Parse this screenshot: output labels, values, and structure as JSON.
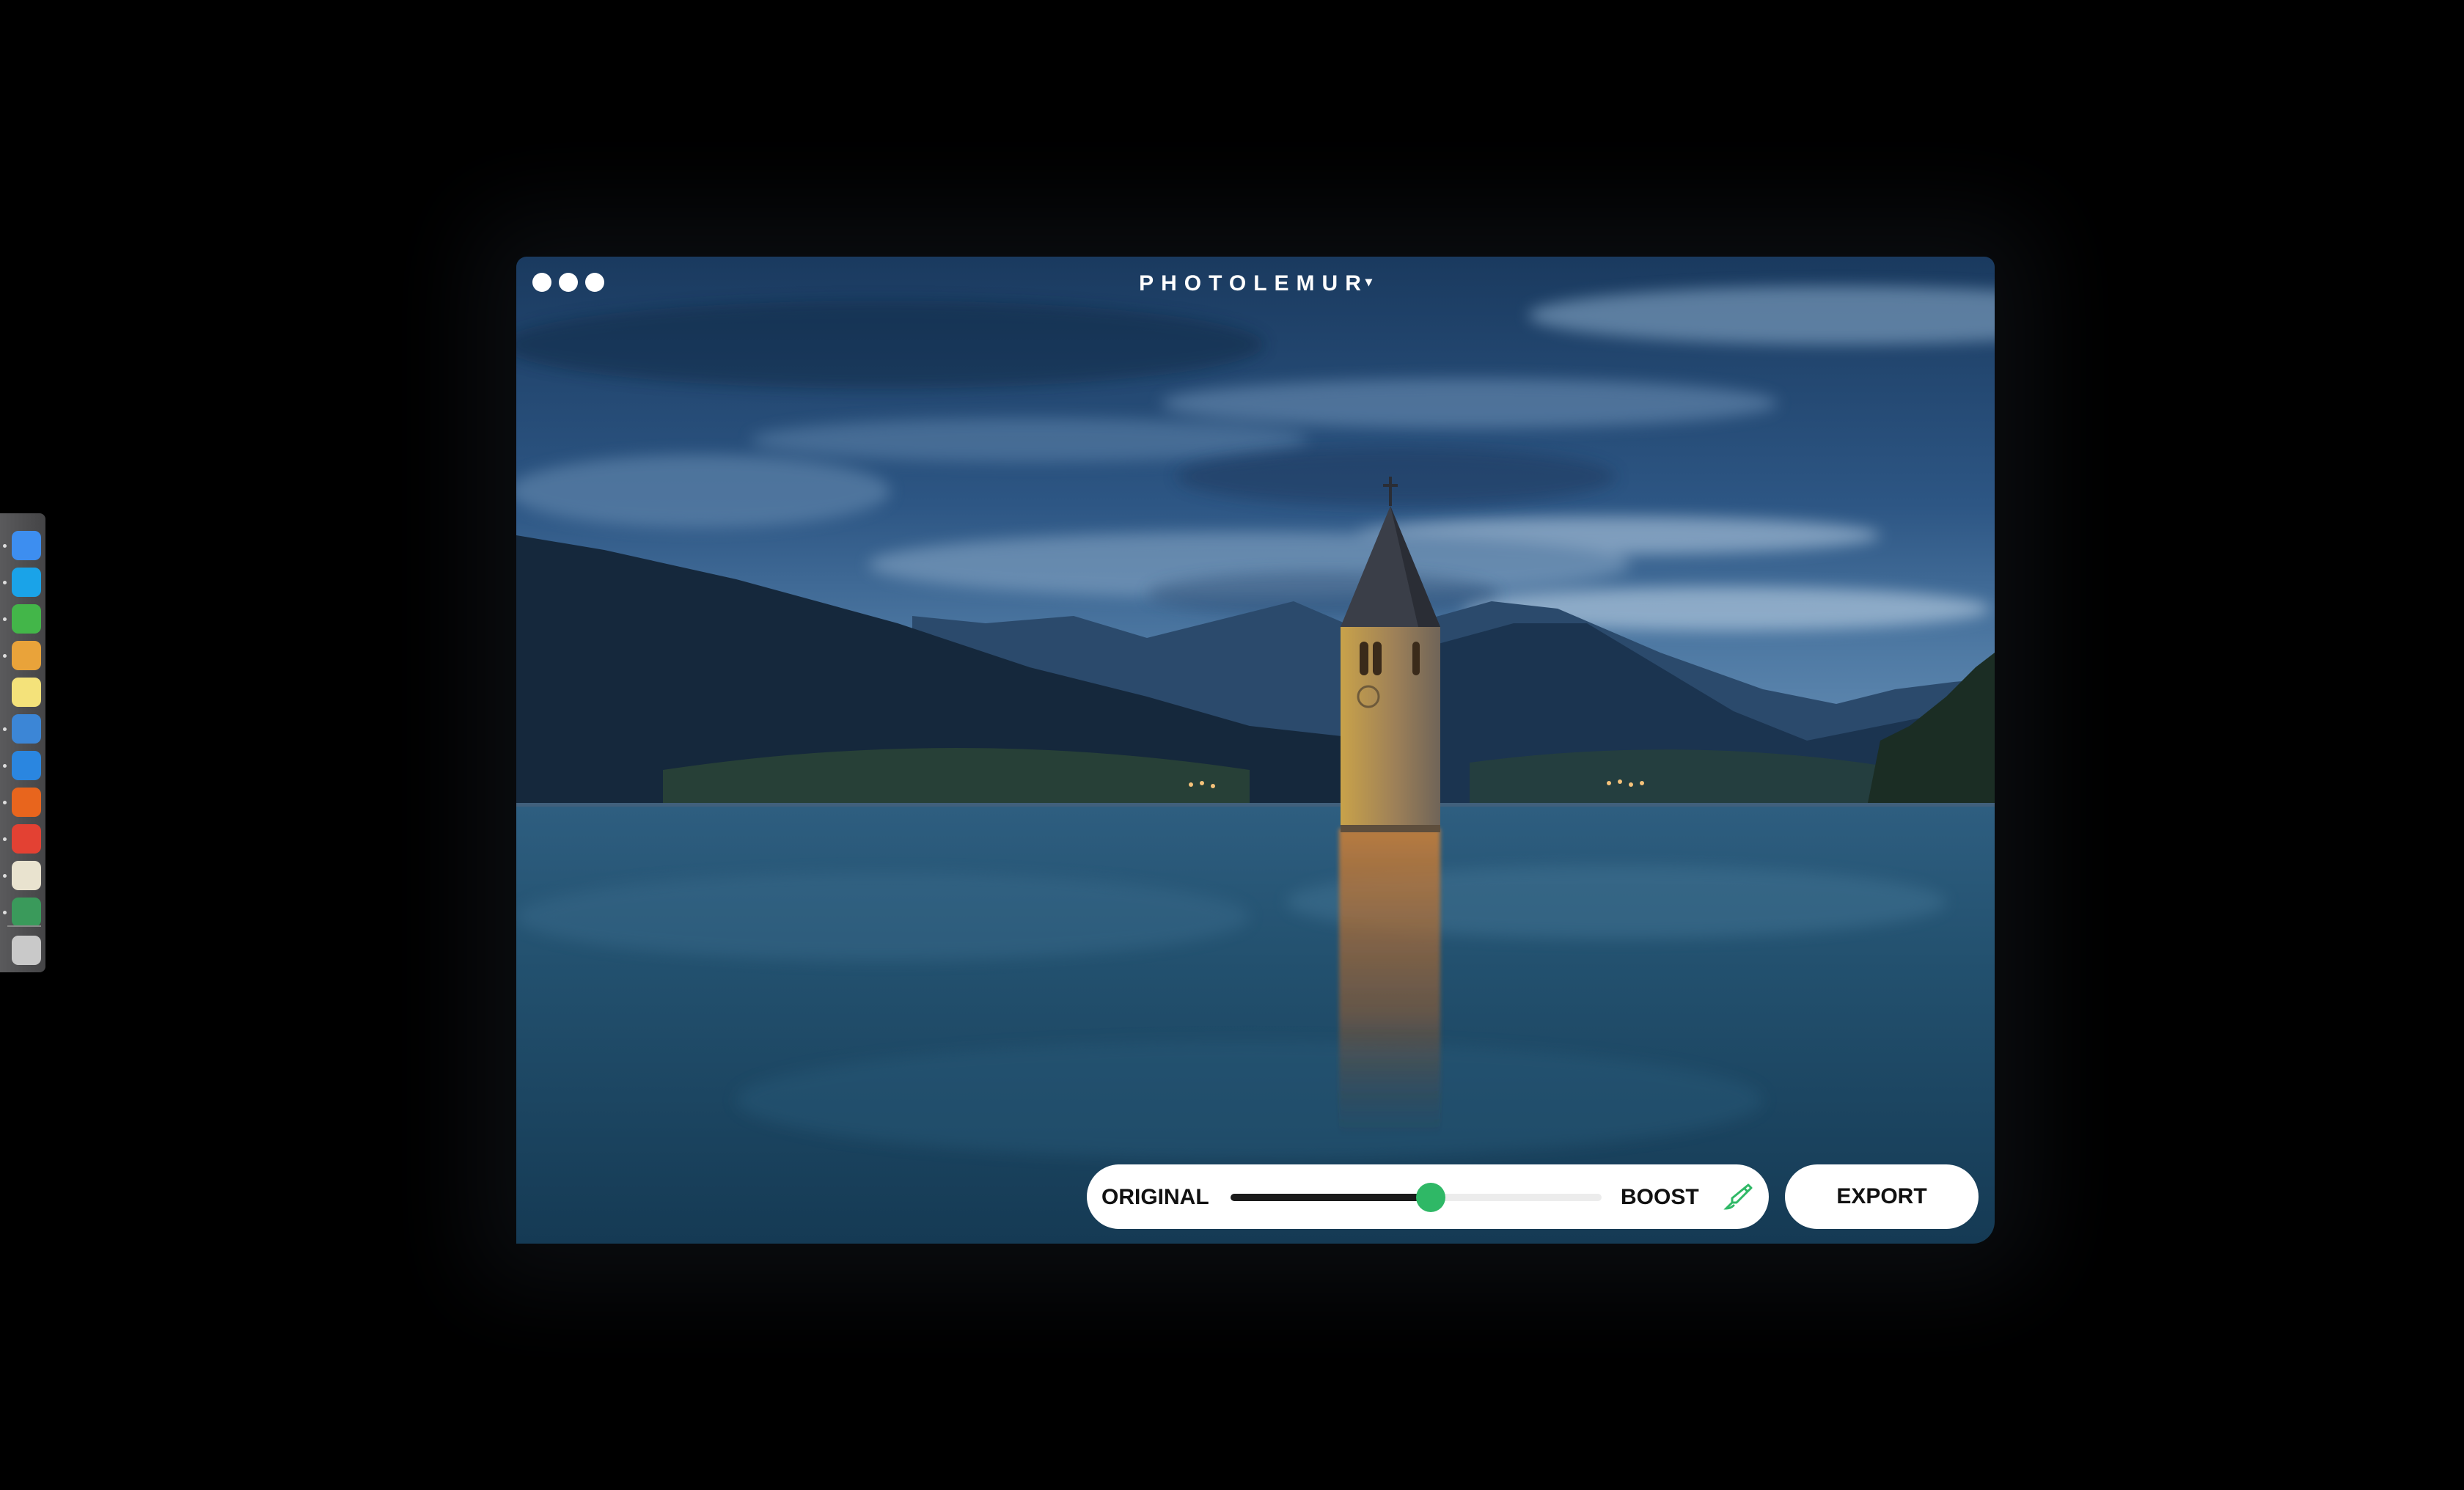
{
  "app": {
    "title": "PHOTOLEMUR",
    "title_caret": "▾"
  },
  "enhance": {
    "left_label": "ORIGINAL",
    "right_label": "BOOST",
    "level_fraction": 0.54,
    "accent_color": "#2fb866"
  },
  "export_button": {
    "label": "EXPORT"
  },
  "dock": {
    "items": [
      {
        "name": "finder-icon",
        "color": "#3d8ef0",
        "running": true
      },
      {
        "name": "skype-icon",
        "color": "#1aa3e8",
        "running": true
      },
      {
        "name": "evernote-icon",
        "color": "#43b649",
        "running": true
      },
      {
        "name": "sublime-icon",
        "color": "#e9a33a",
        "running": true
      },
      {
        "name": "notes-icon",
        "color": "#f4e27a",
        "running": false
      },
      {
        "name": "layers-icon",
        "color": "#3c86d6",
        "running": true
      },
      {
        "name": "safari-icon",
        "color": "#2a86e0",
        "running": true
      },
      {
        "name": "firefox-icon",
        "color": "#e8651d",
        "running": true
      },
      {
        "name": "chrome-icon",
        "color": "#e34133",
        "running": true
      },
      {
        "name": "textedit-icon",
        "color": "#e9e3cf",
        "running": true
      },
      {
        "name": "network-icon",
        "color": "#3a9a5b",
        "running": true
      }
    ],
    "trash": {
      "name": "trash-icon",
      "color": "#c9c9c9"
    }
  }
}
